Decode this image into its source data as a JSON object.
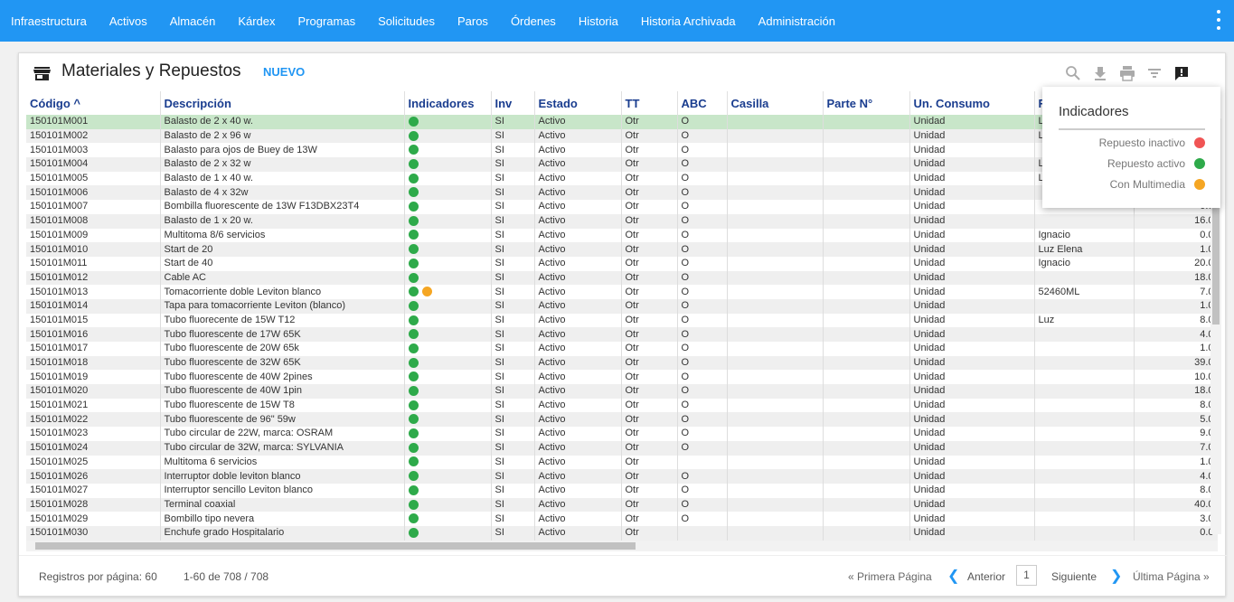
{
  "nav": [
    "Infraestructura",
    "Activos",
    "Almacén",
    "Kárdex",
    "Programas",
    "Solicitudes",
    "Paros",
    "Órdenes",
    "Historia",
    "Historia Archivada",
    "Administración"
  ],
  "header": {
    "title": "Materiales y Repuestos",
    "new_label": "NUEVO"
  },
  "toolbar_icons": [
    "search-icon",
    "download-icon",
    "print-icon",
    "filter-icon",
    "indicators-icon"
  ],
  "colors": {
    "nav": "#2196f3",
    "inactive": "#f05454",
    "active": "#2eaa4a",
    "multimedia": "#f5a623",
    "selected_row": "#c8e6c9"
  },
  "columns": [
    "Código ^",
    "Descripción",
    "Indicadores",
    "Inv",
    "Estado",
    "TT",
    "ABC",
    "Casilla",
    "Parte N°",
    "Un. Consumo",
    "R",
    ""
  ],
  "rows": [
    {
      "codigo": "150101M001",
      "descripcion": "Balasto de 2 x 40 w.",
      "ind": [
        "active"
      ],
      "inv": "SI",
      "estado": "Activo",
      "tt": "Otr",
      "abc": "O",
      "casilla": "",
      "parte": "",
      "un": "Unidad",
      "r": "L",
      "num": ""
    },
    {
      "codigo": "150101M002",
      "descripcion": "Balasto de 2 x 96 w",
      "ind": [
        "active"
      ],
      "inv": "SI",
      "estado": "Activo",
      "tt": "Otr",
      "abc": "O",
      "casilla": "",
      "parte": "",
      "un": "Unidad",
      "r": "L",
      "num": ""
    },
    {
      "codigo": "150101M003",
      "descripcion": "Balasto para ojos de Buey de 13W",
      "ind": [
        "active"
      ],
      "inv": "SI",
      "estado": "Activo",
      "tt": "Otr",
      "abc": "O",
      "casilla": "",
      "parte": "",
      "un": "Unidad",
      "r": "",
      "num": ""
    },
    {
      "codigo": "150101M004",
      "descripcion": "Balasto de 2 x 32 w",
      "ind": [
        "active"
      ],
      "inv": "SI",
      "estado": "Activo",
      "tt": "Otr",
      "abc": "O",
      "casilla": "",
      "parte": "",
      "un": "Unidad",
      "r": "L",
      "num": ""
    },
    {
      "codigo": "150101M005",
      "descripcion": "Balasto de 1 x 40 w.",
      "ind": [
        "active"
      ],
      "inv": "SI",
      "estado": "Activo",
      "tt": "Otr",
      "abc": "O",
      "casilla": "",
      "parte": "",
      "un": "Unidad",
      "r": "L",
      "num": ""
    },
    {
      "codigo": "150101M006",
      "descripcion": "Balasto de 4 x 32w",
      "ind": [
        "active"
      ],
      "inv": "SI",
      "estado": "Activo",
      "tt": "Otr",
      "abc": "O",
      "casilla": "",
      "parte": "",
      "un": "Unidad",
      "r": "",
      "num": ""
    },
    {
      "codigo": "150101M007",
      "descripcion": "Bombilla fluorescente de 13W F13DBX23T4",
      "ind": [
        "active"
      ],
      "inv": "SI",
      "estado": "Activo",
      "tt": "Otr",
      "abc": "O",
      "casilla": "",
      "parte": "",
      "un": "Unidad",
      "r": "",
      "num": "0.0"
    },
    {
      "codigo": "150101M008",
      "descripcion": "Balasto de 1 x 20 w.",
      "ind": [
        "active"
      ],
      "inv": "SI",
      "estado": "Activo",
      "tt": "Otr",
      "abc": "O",
      "casilla": "",
      "parte": "",
      "un": "Unidad",
      "r": "",
      "num": "16.0"
    },
    {
      "codigo": "150101M009",
      "descripcion": "Multitoma 8/6 servicios",
      "ind": [
        "active"
      ],
      "inv": "SI",
      "estado": "Activo",
      "tt": "Otr",
      "abc": "O",
      "casilla": "",
      "parte": "",
      "un": "Unidad",
      "r": "Ignacio",
      "num": "0.0"
    },
    {
      "codigo": "150101M010",
      "descripcion": "Start de 20",
      "ind": [
        "active"
      ],
      "inv": "SI",
      "estado": "Activo",
      "tt": "Otr",
      "abc": "O",
      "casilla": "",
      "parte": "",
      "un": "Unidad",
      "r": "Luz Elena",
      "num": "1.0"
    },
    {
      "codigo": "150101M011",
      "descripcion": "Start de 40",
      "ind": [
        "active"
      ],
      "inv": "SI",
      "estado": "Activo",
      "tt": "Otr",
      "abc": "O",
      "casilla": "",
      "parte": "",
      "un": "Unidad",
      "r": "Ignacio",
      "num": "20.0"
    },
    {
      "codigo": "150101M012",
      "descripcion": "Cable AC",
      "ind": [
        "active"
      ],
      "inv": "SI",
      "estado": "Activo",
      "tt": "Otr",
      "abc": "O",
      "casilla": "",
      "parte": "",
      "un": "Unidad",
      "r": "",
      "num": "18.0"
    },
    {
      "codigo": "150101M013",
      "descripcion": "Tomacorriente doble Leviton blanco",
      "ind": [
        "active",
        "multimedia"
      ],
      "inv": "SI",
      "estado": "Activo",
      "tt": "Otr",
      "abc": "O",
      "casilla": "",
      "parte": "",
      "un": "Unidad",
      "r": "52460ML",
      "num": "7.0"
    },
    {
      "codigo": "150101M014",
      "descripcion": "Tapa para tomacorriente Leviton (blanco)",
      "ind": [
        "active"
      ],
      "inv": "SI",
      "estado": "Activo",
      "tt": "Otr",
      "abc": "O",
      "casilla": "",
      "parte": "",
      "un": "Unidad",
      "r": "",
      "num": "1.0"
    },
    {
      "codigo": "150101M015",
      "descripcion": "Tubo fluorecente de 15W T12",
      "ind": [
        "active"
      ],
      "inv": "SI",
      "estado": "Activo",
      "tt": "Otr",
      "abc": "O",
      "casilla": "",
      "parte": "",
      "un": "Unidad",
      "r": "Luz",
      "num": "8.0"
    },
    {
      "codigo": "150101M016",
      "descripcion": "Tubo fluorescente de 17W 65K",
      "ind": [
        "active"
      ],
      "inv": "SI",
      "estado": "Activo",
      "tt": "Otr",
      "abc": "O",
      "casilla": "",
      "parte": "",
      "un": "Unidad",
      "r": "",
      "num": "4.0"
    },
    {
      "codigo": "150101M017",
      "descripcion": "Tubo fluorescente de 20W 65k",
      "ind": [
        "active"
      ],
      "inv": "SI",
      "estado": "Activo",
      "tt": "Otr",
      "abc": "O",
      "casilla": "",
      "parte": "",
      "un": "Unidad",
      "r": "",
      "num": "1.0"
    },
    {
      "codigo": "150101M018",
      "descripcion": "Tubo fluorescente de 32W 65K",
      "ind": [
        "active"
      ],
      "inv": "SI",
      "estado": "Activo",
      "tt": "Otr",
      "abc": "O",
      "casilla": "",
      "parte": "",
      "un": "Unidad",
      "r": "",
      "num": "39.0"
    },
    {
      "codigo": "150101M019",
      "descripcion": "Tubo fluorescente de 40W 2pines",
      "ind": [
        "active"
      ],
      "inv": "SI",
      "estado": "Activo",
      "tt": "Otr",
      "abc": "O",
      "casilla": "",
      "parte": "",
      "un": "Unidad",
      "r": "",
      "num": "10.0"
    },
    {
      "codigo": "150101M020",
      "descripcion": "Tubo fluorescente de 40W 1pin",
      "ind": [
        "active"
      ],
      "inv": "SI",
      "estado": "Activo",
      "tt": "Otr",
      "abc": "O",
      "casilla": "",
      "parte": "",
      "un": "Unidad",
      "r": "",
      "num": "18.0"
    },
    {
      "codigo": "150101M021",
      "descripcion": "Tubo fluorescente de 15W T8",
      "ind": [
        "active"
      ],
      "inv": "SI",
      "estado": "Activo",
      "tt": "Otr",
      "abc": "O",
      "casilla": "",
      "parte": "",
      "un": "Unidad",
      "r": "",
      "num": "8.0"
    },
    {
      "codigo": "150101M022",
      "descripcion": "Tubo fluorescente de 96\" 59w",
      "ind": [
        "active"
      ],
      "inv": "SI",
      "estado": "Activo",
      "tt": "Otr",
      "abc": "O",
      "casilla": "",
      "parte": "",
      "un": "Unidad",
      "r": "",
      "num": "5.0"
    },
    {
      "codigo": "150101M023",
      "descripcion": "Tubo circular de 22W, marca: OSRAM",
      "ind": [
        "active"
      ],
      "inv": "SI",
      "estado": "Activo",
      "tt": "Otr",
      "abc": "O",
      "casilla": "",
      "parte": "",
      "un": "Unidad",
      "r": "",
      "num": "9.0"
    },
    {
      "codigo": "150101M024",
      "descripcion": "Tubo circular de 32W, marca: SYLVANIA",
      "ind": [
        "active"
      ],
      "inv": "SI",
      "estado": "Activo",
      "tt": "Otr",
      "abc": "O",
      "casilla": "",
      "parte": "",
      "un": "Unidad",
      "r": "",
      "num": "7.0"
    },
    {
      "codigo": "150101M025",
      "descripcion": "Multitoma 6 servicios",
      "ind": [
        "active"
      ],
      "inv": "SI",
      "estado": "Activo",
      "tt": "Otr",
      "abc": "",
      "casilla": "",
      "parte": "",
      "un": "Unidad",
      "r": "",
      "num": "1.0"
    },
    {
      "codigo": "150101M026",
      "descripcion": "Interruptor doble leviton blanco",
      "ind": [
        "active"
      ],
      "inv": "SI",
      "estado": "Activo",
      "tt": "Otr",
      "abc": "O",
      "casilla": "",
      "parte": "",
      "un": "Unidad",
      "r": "",
      "num": "4.0"
    },
    {
      "codigo": "150101M027",
      "descripcion": "Interruptor sencillo Leviton blanco",
      "ind": [
        "active"
      ],
      "inv": "SI",
      "estado": "Activo",
      "tt": "Otr",
      "abc": "O",
      "casilla": "",
      "parte": "",
      "un": "Unidad",
      "r": "",
      "num": "8.0"
    },
    {
      "codigo": "150101M028",
      "descripcion": "Terminal coaxial",
      "ind": [
        "active"
      ],
      "inv": "SI",
      "estado": "Activo",
      "tt": "Otr",
      "abc": "O",
      "casilla": "",
      "parte": "",
      "un": "Unidad",
      "r": "",
      "num": "40.0"
    },
    {
      "codigo": "150101M029",
      "descripcion": "Bombillo tipo nevera",
      "ind": [
        "active"
      ],
      "inv": "SI",
      "estado": "Activo",
      "tt": "Otr",
      "abc": "O",
      "casilla": "",
      "parte": "",
      "un": "Unidad",
      "r": "",
      "num": "3.0"
    },
    {
      "codigo": "150101M030",
      "descripcion": "Enchufe grado Hospitalario",
      "ind": [
        "active"
      ],
      "inv": "SI",
      "estado": "Activo",
      "tt": "Otr",
      "abc": "",
      "casilla": "",
      "parte": "",
      "un": "Unidad",
      "r": "",
      "num": "0.0"
    }
  ],
  "legend": {
    "title": "Indicadores",
    "items": [
      {
        "label": "Repuesto inactivo",
        "color": "#f05454"
      },
      {
        "label": "Repuesto activo",
        "color": "#2eaa4a"
      },
      {
        "label": "Con Multimedia",
        "color": "#f5a623"
      }
    ]
  },
  "footer": {
    "per_page": "Registros por página: 60",
    "range": "1-60 de 708 / 708",
    "first": "« Primera Página",
    "prev": "Anterior",
    "page": "1",
    "next": "Siguiente",
    "last": "Última Página »"
  }
}
